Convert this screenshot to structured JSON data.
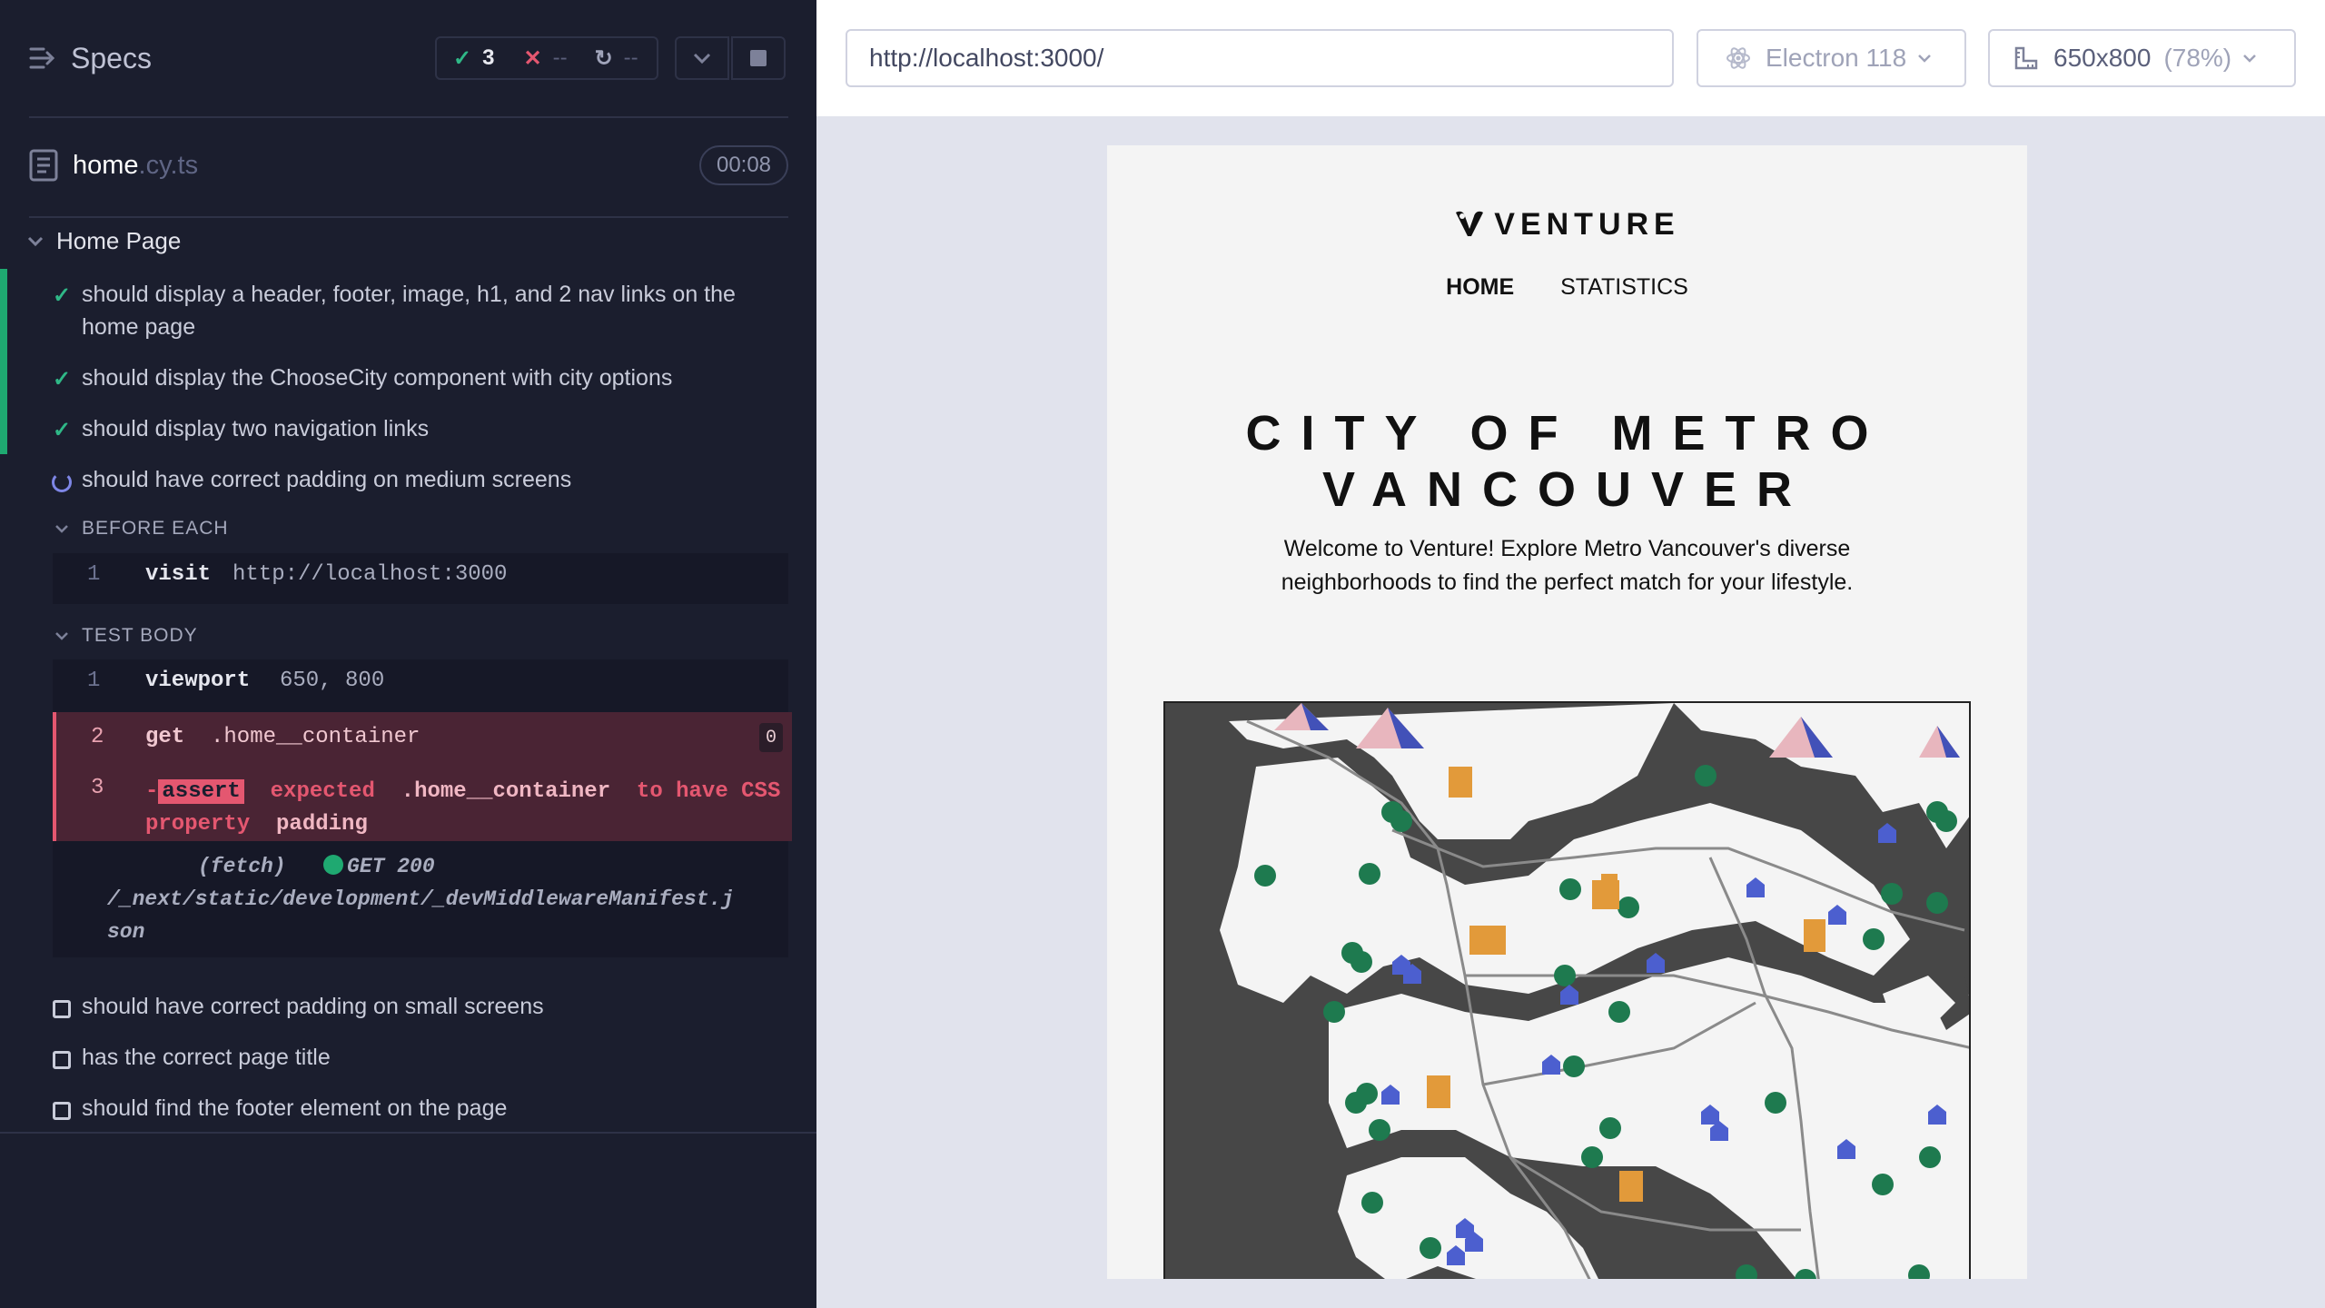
{
  "runner": {
    "specs_label": "Specs",
    "stats": {
      "passed": "3",
      "failed": "--",
      "pending": "--"
    },
    "spec_file": {
      "name": "home",
      "ext": ".cy.ts",
      "duration": "00:08"
    },
    "suite_title": "Home Page",
    "tests": [
      {
        "title": "should display a header, footer, image, h1, and 2 nav links on the home page",
        "state": "passed"
      },
      {
        "title": "should display the ChooseCity component with city options",
        "state": "passed"
      },
      {
        "title": "should display two navigation links",
        "state": "passed"
      },
      {
        "title": "should have correct padding on medium screens",
        "state": "running"
      },
      {
        "title": "should have correct padding on small screens",
        "state": "pending"
      },
      {
        "title": "has the correct page title",
        "state": "pending"
      },
      {
        "title": "should find the footer element on the page",
        "state": "pending"
      }
    ],
    "before_each": {
      "label": "BEFORE EACH",
      "commands": [
        {
          "num": "1",
          "name": "visit",
          "message": "http://localhost:3000"
        }
      ]
    },
    "test_body": {
      "label": "TEST BODY",
      "commands": [
        {
          "num": "1",
          "name": "viewport",
          "message": "650, 800"
        },
        {
          "num": "2",
          "name": "get",
          "message": ".home__container",
          "badge": "0"
        },
        {
          "num": "3",
          "prefix": "-",
          "name": "assert",
          "message_parts": [
            "expected",
            ".home__container",
            "to have CSS",
            "property",
            "padding"
          ]
        }
      ],
      "fetch": {
        "label": "(fetch)",
        "method": "GET 200",
        "url": "/_next/static/development/_devMiddlewareManifest.json"
      }
    }
  },
  "browser_bar": {
    "url": "http://localhost:3000/",
    "browser": "Electron 118",
    "viewport": "650x800",
    "scale": "(78%)"
  },
  "app": {
    "logo": "VENTURE",
    "nav": [
      "HOME",
      "STATISTICS"
    ],
    "heading_line1": "CITY OF METRO",
    "heading_line2": "VANCOUVER",
    "lead_line1": "Welcome to Venture! Explore Metro Vancouver's diverse",
    "lead_line2": "neighborhoods to find the perfect match for your lifestyle."
  },
  "colors": {
    "pass": "#2fb887",
    "fail": "#e45770",
    "running": "#7e86e6",
    "panel": "#1b1e2e"
  }
}
